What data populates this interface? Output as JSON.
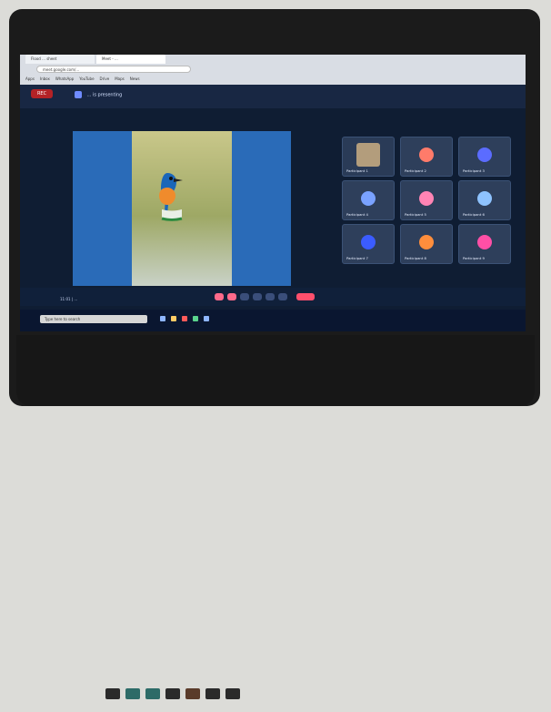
{
  "browser": {
    "tabs": [
      {
        "label": "Flood ... sheet",
        "active": false
      },
      {
        "label": "Meet - ...",
        "active": true
      }
    ],
    "address": "meet.google.com/...",
    "bookmarks": [
      "Apps",
      "Inbox",
      "WhatsApp",
      "YouTube",
      "Drive",
      "Maps",
      "News"
    ]
  },
  "meet": {
    "rec": "REC",
    "presenting_label": "... is presenting",
    "meeting_code": "11:01 | ...",
    "participants": [
      {
        "name": "Participant 1",
        "type": "video"
      },
      {
        "name": "Participant 2",
        "type": "avatar"
      },
      {
        "name": "Participant 3",
        "type": "avatar"
      },
      {
        "name": "Participant 4",
        "type": "avatar"
      },
      {
        "name": "Participant 5",
        "type": "avatar"
      },
      {
        "name": "Participant 6",
        "type": "avatar"
      },
      {
        "name": "Participant 7",
        "type": "avatar"
      },
      {
        "name": "Participant 8",
        "type": "avatar"
      },
      {
        "name": "Participant 9",
        "type": "avatar"
      }
    ]
  },
  "taskbar": {
    "search_placeholder": "Type here to search"
  },
  "colors": {
    "screen_bg": "#0f1d33",
    "meet_bar": "#182743",
    "accent_pink": "#ff6a8a",
    "accent_blue": "#5b6cff",
    "rec_red": "#b42226"
  }
}
